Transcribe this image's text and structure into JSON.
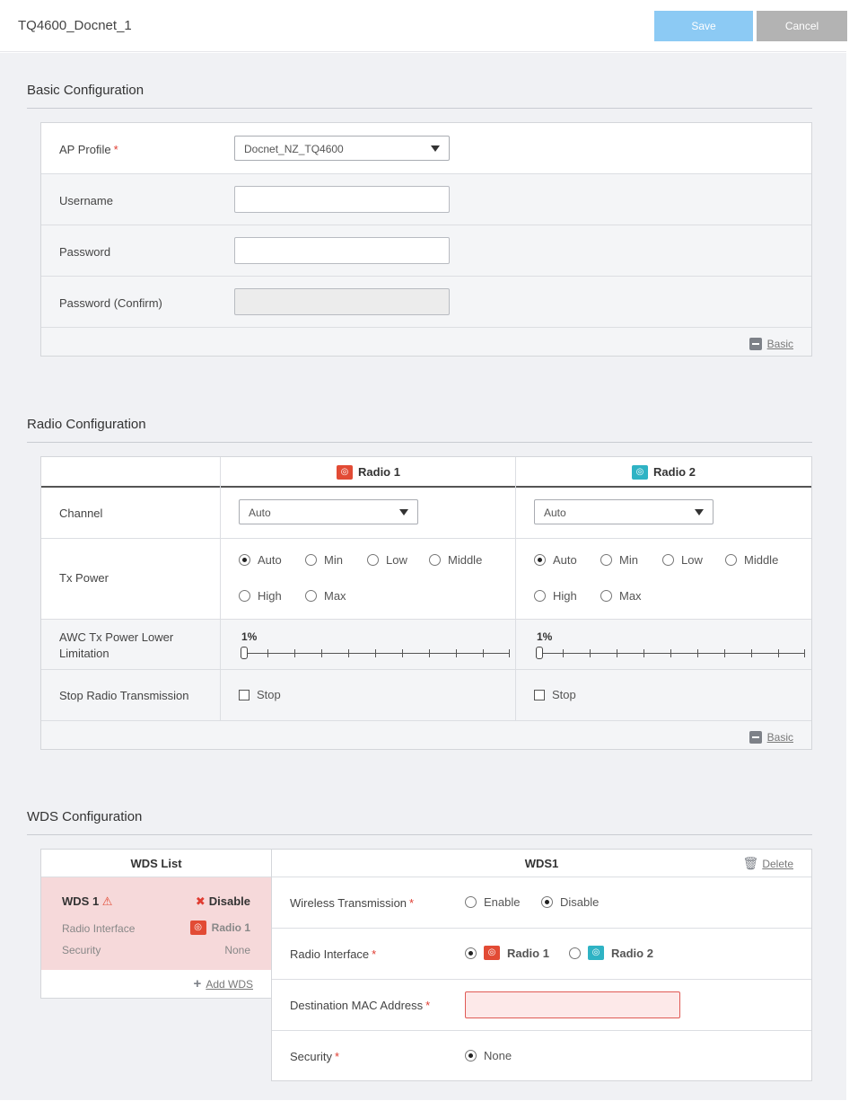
{
  "header": {
    "title": "TQ4600_Docnet_1",
    "save_label": "Save",
    "cancel_label": "Cancel"
  },
  "basic": {
    "section_title": "Basic Configuration",
    "ap_profile_label": "AP Profile",
    "ap_profile_value": "Docnet_NZ_TQ4600",
    "username_label": "Username",
    "password_label": "Password",
    "password_confirm_label": "Password (Confirm)",
    "footer_link": "Basic"
  },
  "radio": {
    "section_title": "Radio Configuration",
    "radio1_label": "Radio 1",
    "radio2_label": "Radio 2",
    "channel_label": "Channel",
    "channel1_value": "Auto",
    "channel2_value": "Auto",
    "tx_power_label": "Tx Power",
    "tx_options": [
      "Auto",
      "Min",
      "Low",
      "Middle",
      "High",
      "Max"
    ],
    "tx_selected": "Auto",
    "awc_label_line1": "AWC Tx Power Lower",
    "awc_label_line2": "Limitation",
    "awc1_value": "1%",
    "awc2_value": "1%",
    "stop_label": "Stop Radio Transmission",
    "stop_option": "Stop",
    "footer_link": "Basic"
  },
  "wds": {
    "section_title": "WDS Configuration",
    "list_title": "WDS List",
    "item": {
      "name": "WDS 1",
      "status": "Disable",
      "radio_interface_label": "Radio Interface",
      "radio_interface_value": "Radio 1",
      "security_label": "Security",
      "security_value": "None"
    },
    "add_label": "Add WDS",
    "detail_title": "WDS1",
    "delete_label": "Delete",
    "wireless_label": "Wireless Transmission",
    "enable_label": "Enable",
    "disable_label": "Disable",
    "radio_interface_label": "Radio Interface",
    "radio1_label": "Radio 1",
    "radio2_label": "Radio 2",
    "dest_mac_label": "Destination MAC Address",
    "security_label": "Security",
    "security_none": "None"
  },
  "colors": {
    "save_button": "#8ccaf4",
    "cancel_button": "#b3b3b3",
    "required": "#e03c31",
    "radio1": "#e24b35",
    "radio2": "#2fb3c4",
    "wds_item_bg": "#f6d9da"
  }
}
